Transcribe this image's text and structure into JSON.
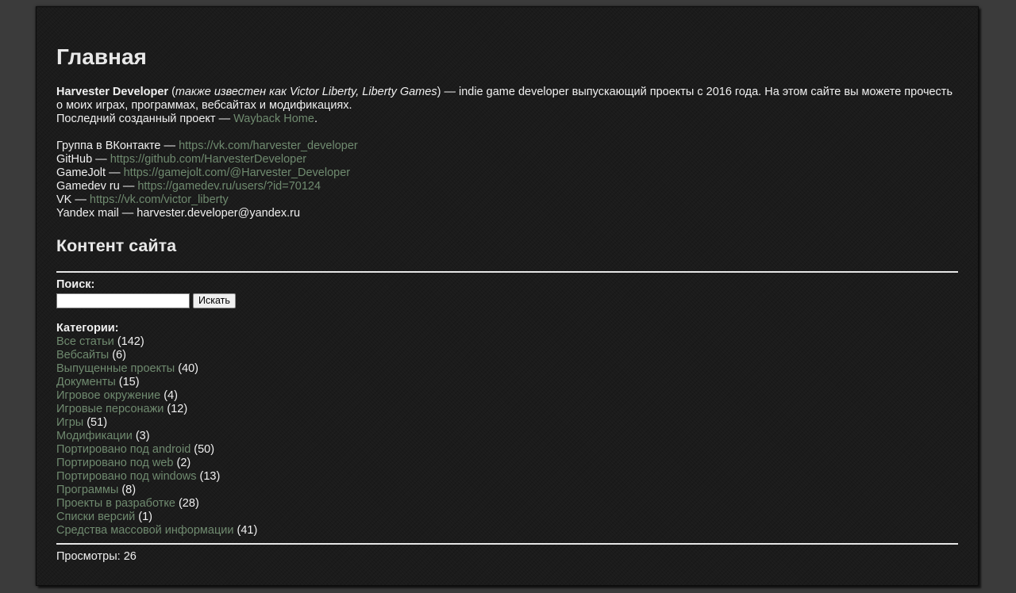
{
  "title": "Главная",
  "intro": {
    "name": "Harvester Developer",
    "paren_open": " (",
    "aka": "также известен как Victor Liberty, Liberty Games",
    "paren_close": ")",
    "rest": " — indie game developer выпускающий проекты с 2016 года. На этом сайте вы можете прочесть о моих играх, программах, вебсайтах и модификациях.",
    "last_project_label": "Последний созданный проект — ",
    "last_project_link": "Wayback Home",
    "last_project_end": "."
  },
  "contacts": [
    {
      "label": "Группа в ВКонтакте — ",
      "value": "https://vk.com/harvester_developer",
      "is_link": true
    },
    {
      "label": "GitHub — ",
      "value": "https://github.com/HarvesterDeveloper",
      "is_link": true
    },
    {
      "label": "GameJolt — ",
      "value": "https://gamejolt.com/@Harvester_Developer",
      "is_link": true
    },
    {
      "label": "Gamedev ru — ",
      "value": "https://gamedev.ru/users/?id=70124",
      "is_link": true
    },
    {
      "label": "VK — ",
      "value": "https://vk.com/victor_liberty",
      "is_link": true
    },
    {
      "label": "Yandex mail — ",
      "value": "harvester.developer@yandex.ru",
      "is_link": false
    }
  ],
  "content_heading": "Контент сайта",
  "search": {
    "label": "Поиск:",
    "input_value": "",
    "button_label": "Искать"
  },
  "categories": {
    "label": "Категории:",
    "items": [
      {
        "name": "Все статьи",
        "count": " (142)"
      },
      {
        "name": "Вебсайты",
        "count": " (6)"
      },
      {
        "name": "Выпущенные проекты",
        "count": " (40)"
      },
      {
        "name": "Документы",
        "count": " (15)"
      },
      {
        "name": "Игровое окружение",
        "count": " (4)"
      },
      {
        "name": "Игровые персонажи",
        "count": " (12)"
      },
      {
        "name": "Игры",
        "count": " (51)"
      },
      {
        "name": "Модификации",
        "count": " (3)"
      },
      {
        "name": "Портировано под android",
        "count": " (50)"
      },
      {
        "name": "Портировано под web",
        "count": " (2)"
      },
      {
        "name": "Портировано под windows",
        "count": " (13)"
      },
      {
        "name": "Программы",
        "count": " (8)"
      },
      {
        "name": "Проекты в разработке",
        "count": " (28)"
      },
      {
        "name": "Списки версий",
        "count": " (1)"
      },
      {
        "name": "Средства массовой информации",
        "count": " (41)"
      }
    ]
  },
  "views": "Просмотры: 26",
  "colors": {
    "background": "#1b1b1b",
    "outer_background": "#3b3b3b",
    "text": "#f0f0f0",
    "link": "#6f8a6f",
    "rule": "#e6e6e6"
  }
}
